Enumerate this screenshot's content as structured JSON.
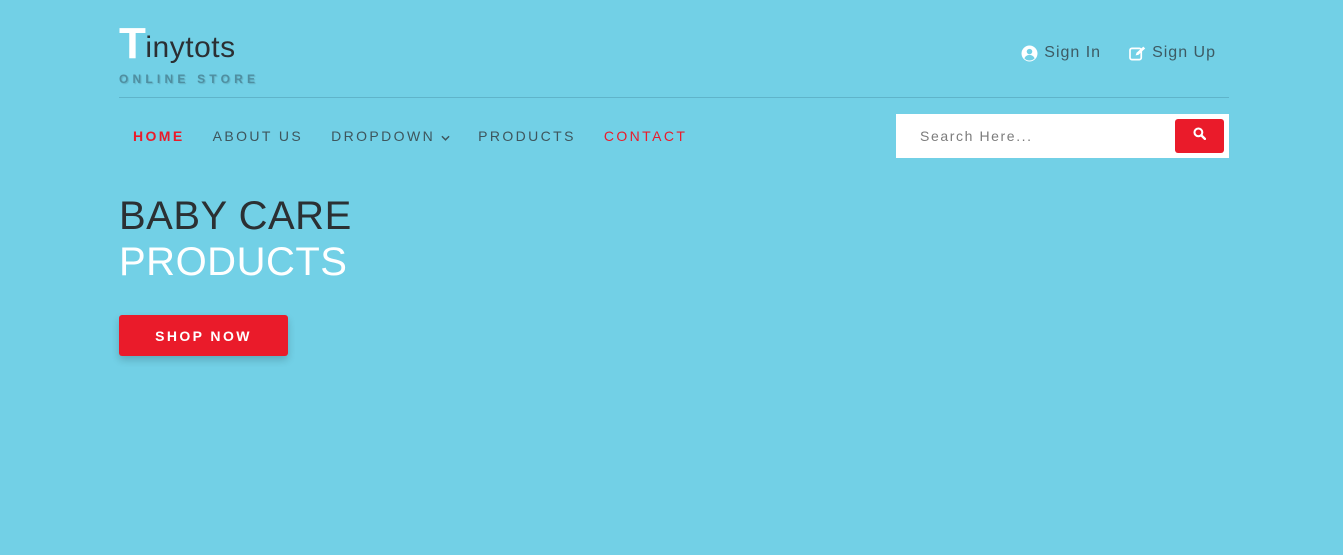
{
  "brand": {
    "initial": "T",
    "rest": "inytots",
    "tagline": "ONLINE STORE"
  },
  "auth": {
    "sign_in": "Sign In",
    "sign_up": "Sign Up"
  },
  "nav": {
    "items": [
      {
        "label": "HOME",
        "state": "active"
      },
      {
        "label": "ABOUT US"
      },
      {
        "label": "DROPDOWN",
        "has_menu": true
      },
      {
        "label": "PRODUCTS"
      },
      {
        "label": "CONTACT",
        "state": "highlight"
      }
    ]
  },
  "search": {
    "placeholder": "Search Here...",
    "button_icon": "search-icon"
  },
  "hero": {
    "line1": "BABY CARE",
    "line2": "PRODUCTS",
    "cta": "SHOP NOW"
  },
  "colors": {
    "background": "#72d0e6",
    "accent": "#ea1b2a",
    "dark_text": "#2b3033",
    "white": "#ffffff"
  },
  "icons": {
    "sign_in": "user-circle-icon",
    "sign_up": "edit-icon",
    "dropdown": "chevron-down-icon"
  }
}
